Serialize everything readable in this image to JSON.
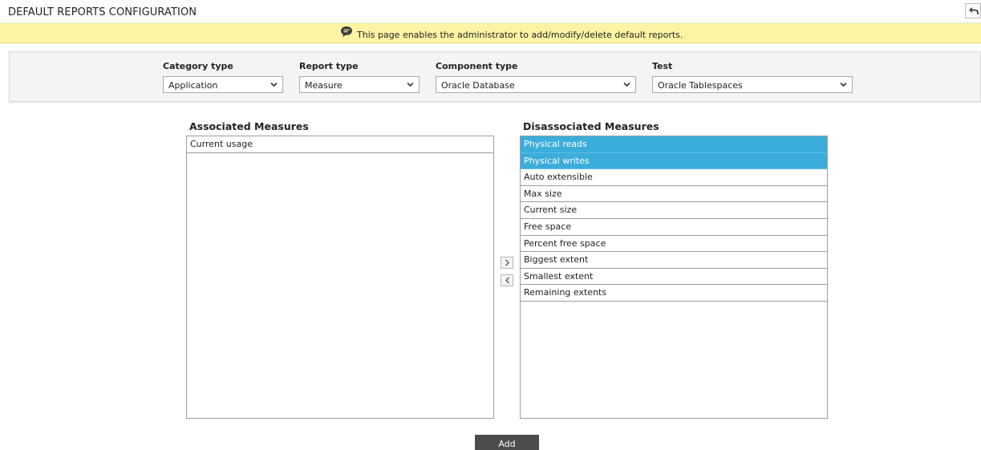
{
  "header": {
    "title": "DEFAULT REPORTS CONFIGURATION"
  },
  "notice": {
    "message": "This page enables the administrator to add/modify/delete default reports."
  },
  "filters": {
    "category_type": {
      "label": "Category type",
      "value": "Application"
    },
    "report_type": {
      "label": "Report type",
      "value": "Measure"
    },
    "component_type": {
      "label": "Component type",
      "value": "Oracle Database"
    },
    "test": {
      "label": "Test",
      "value": "Oracle Tablespaces"
    }
  },
  "associated": {
    "title": "Associated Measures",
    "items": [
      "Current usage"
    ]
  },
  "disassociated": {
    "title": "Disassociated Measures",
    "items": [
      "Physical reads",
      "Physical writes",
      "Auto extensible",
      "Max size",
      "Current size",
      "Free space",
      "Percent free space",
      "Biggest extent",
      "Smallest extent",
      "Remaining extents"
    ],
    "selected": [
      "Physical reads",
      "Physical writes"
    ]
  },
  "actions": {
    "add_label": "Add"
  },
  "colors": {
    "notice_bg": "#fdf4a3",
    "selection": "#3aaddb",
    "add_button": "#4c4c4c"
  },
  "icons": {
    "back": "back-arrow-icon",
    "notice": "speech-bubble-icon",
    "dropdown": "chevron-down-icon",
    "move_right": "chevron-right-icon",
    "move_left": "chevron-left-icon"
  }
}
